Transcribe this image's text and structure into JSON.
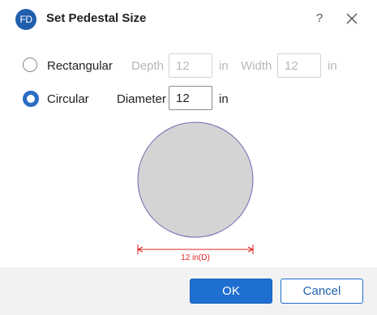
{
  "dialog": {
    "logo_text": "FD",
    "title": "Set Pedestal Size",
    "help_label": "?"
  },
  "rectangular": {
    "label": "Rectangular",
    "selected": false,
    "depth_label": "Depth",
    "depth_value": "12",
    "depth_unit": "in",
    "width_label": "Width",
    "width_value": "12",
    "width_unit": "in"
  },
  "circular": {
    "label": "Circular",
    "selected": true,
    "diameter_label": "Diameter",
    "diameter_value": "12",
    "diameter_unit": "in"
  },
  "preview": {
    "dimension_label": "12 in(D)",
    "fill_color": "#d4d4d4",
    "outline_color": "#6b6bb0",
    "dimension_color": "#e02020"
  },
  "buttons": {
    "ok": "OK",
    "cancel": "Cancel"
  }
}
